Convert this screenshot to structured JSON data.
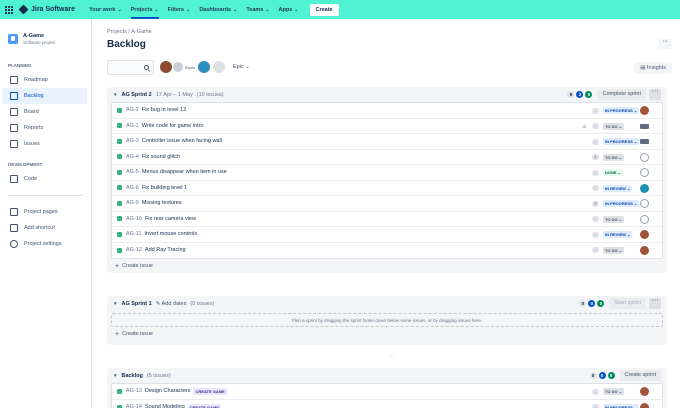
{
  "nav": {
    "product": "Jira Software",
    "items": [
      "Your work",
      "Projects",
      "Filters",
      "Dashboards",
      "Teams",
      "Apps"
    ],
    "active_index": 1,
    "create": "Create"
  },
  "sidebar": {
    "project_name": "A-Game",
    "project_type": "Software project",
    "planning_title": "PLANNING",
    "planning_items": [
      "Roadmap",
      "Backlog",
      "Board",
      "Reports",
      "Issues"
    ],
    "planning_icons": [
      "roadmap-icon",
      "backlog-icon",
      "board-icon",
      "reports-icon",
      "issues-icon"
    ],
    "active_index": 1,
    "development_title": "DEVELOPMENT",
    "development_items": [
      "Code"
    ],
    "other_items": [
      "Project pages",
      "Add shortcut",
      "Project settings"
    ]
  },
  "header": {
    "breadcrumb_projects": "Projects",
    "breadcrumb_sep": "/",
    "breadcrumb_project": "A-Game",
    "title": "Backlog",
    "epic_filter": "Epic",
    "insights": "Insights",
    "avatar_label": "Rocio"
  },
  "sprint2": {
    "name": "AG Sprint 2",
    "dates": "17 Apr – 1 May",
    "count": "(10 issues)",
    "pills": [
      "5",
      "2",
      "0"
    ],
    "action": "Complete sprint",
    "issues": [
      {
        "key": "AG-2",
        "summary": "Fix bug in level 12",
        "status": "IN PROGRESS",
        "type": "prog",
        "estimate": "",
        "avatar": "brown"
      },
      {
        "key": "AG-1",
        "summary": "Write code for game intro",
        "status": "TO DO",
        "type": "todo",
        "estimate": "",
        "avatar": "small",
        "warn": "⚠"
      },
      {
        "key": "AG-3",
        "summary": "Controller issue when facing wall",
        "status": "IN PROGRESS",
        "type": "prog",
        "estimate": "",
        "avatar": "small"
      },
      {
        "key": "AG-4",
        "summary": "Fix sound glitch",
        "status": "TO DO",
        "type": "todo",
        "estimate": "1",
        "avatar": "grey"
      },
      {
        "key": "AG-5",
        "summary": "Menus disappear when item in use",
        "status": "DONE",
        "type": "done",
        "estimate": "",
        "avatar": "grey"
      },
      {
        "key": "AG-6",
        "summary": "Fix building level 1",
        "status": "IN REVIEW",
        "type": "rev",
        "estimate": "",
        "avatar": "teal"
      },
      {
        "key": "AG-9",
        "summary": "Missing textures",
        "status": "IN PROGRESS",
        "type": "prog",
        "estimate": "2",
        "avatar": "grey"
      },
      {
        "key": "AG-10",
        "summary": "Fix rear camera view",
        "status": "TO DO",
        "type": "todo",
        "estimate": "",
        "avatar": "grey"
      },
      {
        "key": "AG-11",
        "summary": "Invert mouse controls",
        "status": "IN REVIEW",
        "type": "rev",
        "estimate": "",
        "avatar": "brown"
      },
      {
        "key": "AG-12",
        "summary": "Add Ray Tracing",
        "status": "TO DO",
        "type": "todo",
        "estimate": "",
        "avatar": "brown"
      }
    ],
    "create_issue": "Create issue"
  },
  "sprint1": {
    "name": "AG Sprint 1",
    "add_dates": "Add dates",
    "count": "(0 issues)",
    "pills": [
      "0",
      "0",
      "0"
    ],
    "action": "Start sprint",
    "drop_hint": "Plan a sprint by dragging the sprint footer down below some issues, or by dragging issues here.",
    "create_issue": "Create issue"
  },
  "backlog": {
    "name": "Backlog",
    "count": "(5 issues)",
    "pills": [
      "0",
      "0",
      "0"
    ],
    "action": "Create sprint",
    "issues": [
      {
        "key": "AG-13",
        "summary": "Design Characters",
        "epic": "CREATE GAME",
        "status": "TO DO",
        "type": "todo",
        "avatar": "brown"
      },
      {
        "key": "AG-14",
        "summary": "Sound Modeling",
        "epic": "CREATE GAME",
        "status": "IN PROGRESS",
        "type": "prog",
        "avatar": "brown"
      }
    ]
  }
}
